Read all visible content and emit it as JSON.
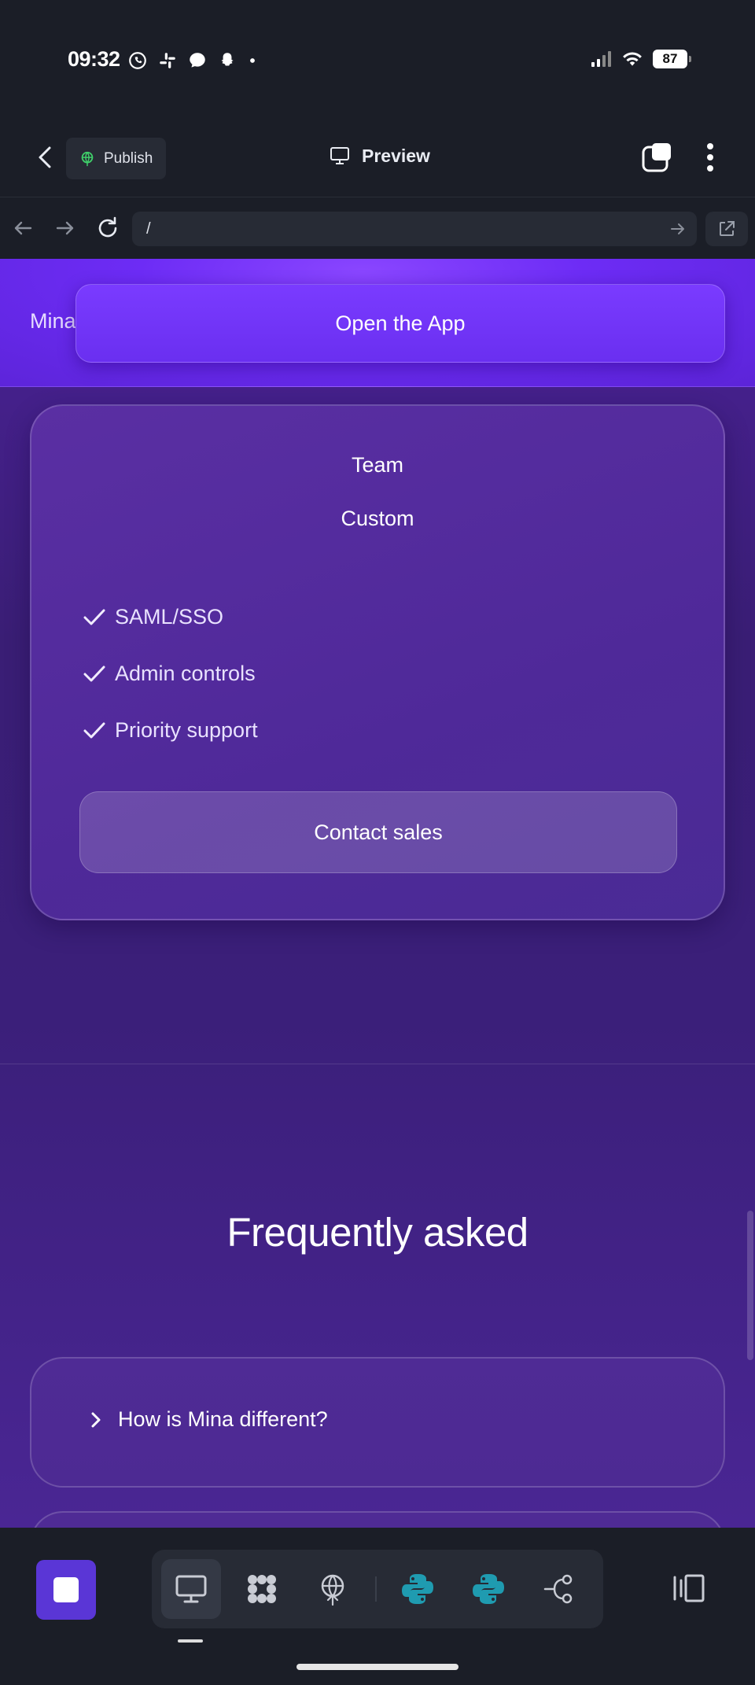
{
  "status_bar": {
    "time": "09:32",
    "notification_icons": [
      "whatsapp-icon",
      "slack-icon",
      "messenger-icon",
      "snapchat-icon",
      "dot-icon"
    ],
    "battery": "87"
  },
  "header": {
    "publish_label": "Publish",
    "preview_label": "Preview"
  },
  "url_bar": {
    "value": "/"
  },
  "site": {
    "brand": "Mina",
    "open_app_label": "Open the App"
  },
  "pricing_card": {
    "plan_name": "Team",
    "price": "Custom",
    "features": [
      "SAML/SSO",
      "Admin controls",
      "Priority support"
    ],
    "cta_label": "Contact sales"
  },
  "faq": {
    "title": "Frequently asked",
    "items": [
      {
        "question": "How is Mina different?"
      }
    ]
  },
  "toolbar": {
    "tools": [
      "desktop-icon",
      "grid-app-icon",
      "publish-icon",
      "python-icon",
      "python-icon",
      "workflow-icon"
    ],
    "active_tool": "desktop-icon"
  },
  "colors": {
    "accent_purple": "#6d2cf5",
    "card_purple": "#5a2fa3",
    "page_background": "#3a1e75",
    "chrome_dark": "#1b1e27",
    "python_teal": "#1f9bb0",
    "stop_button": "#5a36d6"
  }
}
